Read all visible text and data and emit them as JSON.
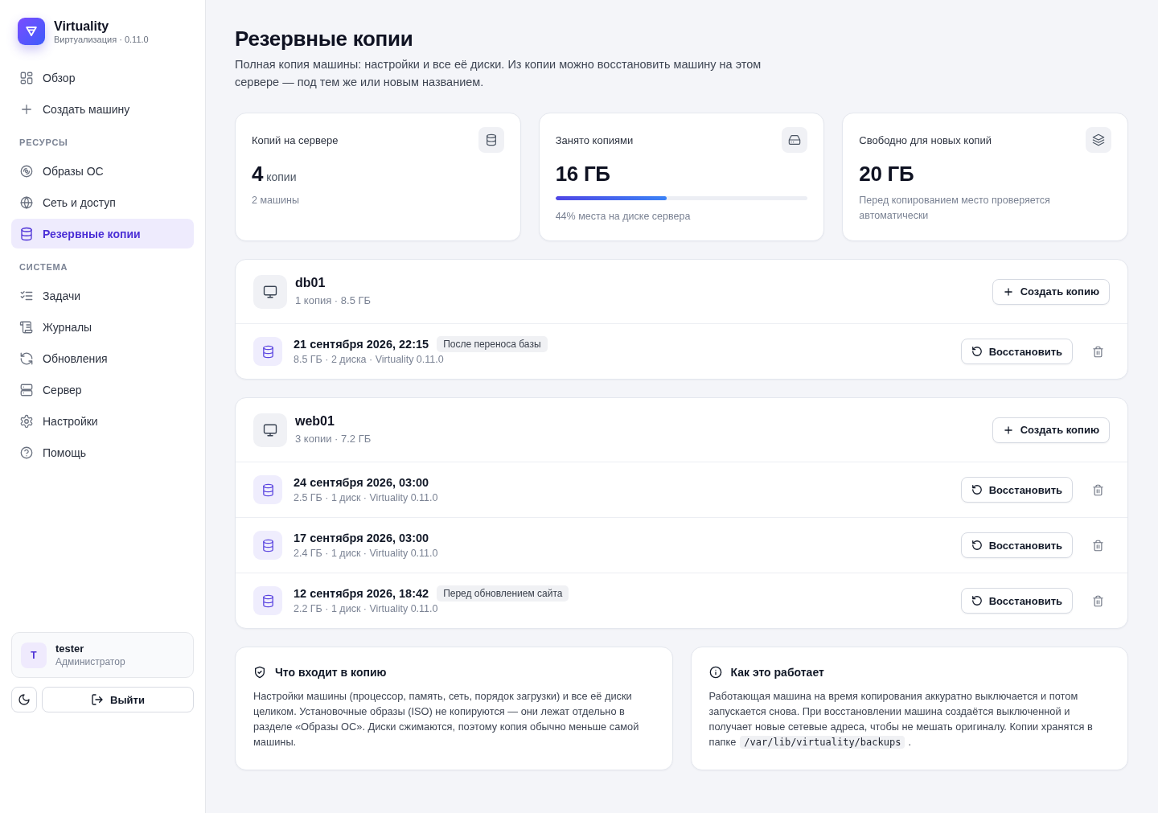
{
  "brand": {
    "name": "Virtuality",
    "subtitle": "Виртуализация · 0.11.0"
  },
  "sidebar": {
    "top_items": [
      {
        "label": "Обзор",
        "selected": false
      },
      {
        "label": "Создать машину",
        "selected": false
      }
    ],
    "sections": [
      {
        "title": "РЕСУРСЫ",
        "items": [
          {
            "label": "Образы ОС",
            "selected": false
          },
          {
            "label": "Сеть и доступ",
            "selected": false
          },
          {
            "label": "Резервные копии",
            "selected": true
          }
        ]
      },
      {
        "title": "СИСТЕМА",
        "items": [
          {
            "label": "Задачи",
            "selected": false
          },
          {
            "label": "Журналы",
            "selected": false
          },
          {
            "label": "Обновления",
            "selected": false
          },
          {
            "label": "Сервер",
            "selected": false
          },
          {
            "label": "Настройки",
            "selected": false
          },
          {
            "label": "Помощь",
            "selected": false
          }
        ]
      }
    ]
  },
  "user": {
    "initial": "T",
    "name": "tester",
    "role": "Администратор"
  },
  "logout_button": "Выйти",
  "page": {
    "title": "Резервные копии",
    "description": "Полная копия машины: настройки и все её диски. Из копии можно восстановить машину на этом сервере — под тем же или новым названием."
  },
  "stats": [
    {
      "label": "Копий на сервере",
      "value": "4",
      "unit": "копии",
      "note": "2 машины"
    },
    {
      "label": "Занято копиями",
      "value": "16 ГБ",
      "level": 0.44,
      "note": "44% места на диске сервера"
    },
    {
      "label": "Свободно для новых копий",
      "value": "20 ГБ",
      "note": "Перед копированием место проверяется автоматически"
    }
  ],
  "machines": [
    {
      "name": "db01",
      "summary": "1 копия · 8.5 ГБ",
      "create_button": "Создать копию",
      "backups": [
        {
          "date": "21 сентября 2026, 22:15",
          "tag": "После переноса базы",
          "details": "8.5 ГБ · 2 диска · Virtuality 0.11.0",
          "restore_button": "Восстановить"
        }
      ]
    },
    {
      "name": "web01",
      "summary": "3 копии · 7.2 ГБ",
      "create_button": "Создать копию",
      "backups": [
        {
          "date": "24 сентября 2026, 03:00",
          "details": "2.5 ГБ · 1 диск · Virtuality 0.11.0",
          "restore_button": "Восстановить"
        },
        {
          "date": "17 сентября 2026, 03:00",
          "details": "2.4 ГБ · 1 диск · Virtuality 0.11.0",
          "restore_button": "Восстановить"
        },
        {
          "date": "12 сентября 2026, 18:42",
          "tag": "Перед обновлением сайта",
          "details": "2.2 ГБ · 1 диск · Virtuality 0.11.0",
          "restore_button": "Восстановить"
        }
      ]
    }
  ],
  "info": [
    {
      "title": "Что входит в копию",
      "text": "Настройки машины (процессор, память, сеть, порядок загрузки) и все её диски целиком. Установочные образы (ISO) не копируются — они лежат отдельно в разделе «Образы ОС». Диски сжимаются, поэтому копия обычно меньше самой машины."
    },
    {
      "title": "Как это работает",
      "text": "Работающая машина на время копирования аккуратно выключается и потом запускается снова. При восстановлении машина создаётся выключенной и получает новые сетевые адреса, чтобы не мешать оригиналу. Копии хранятся в папке",
      "code_path": "/var/lib/virtuality/backups",
      "text_end": "."
    }
  ]
}
